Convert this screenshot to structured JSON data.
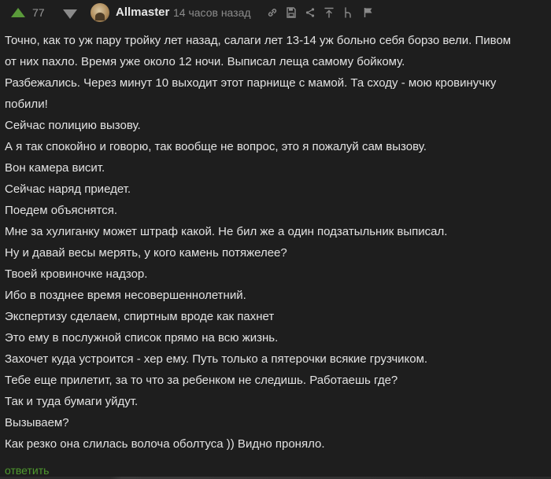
{
  "comment": {
    "rating": "77",
    "username": "Allmaster",
    "time": "14 часов назад",
    "icons": [
      "link-icon",
      "save-icon",
      "share-icon",
      "go-to-parent-icon",
      "branch-icon",
      "flag-icon"
    ],
    "lines": [
      "Точно, как то уж пару тройку лет назад, салаги лет 13-14 уж больно себя борзо вели. Пивом",
      "от них пахло. Время уже около 12 ночи. Выписал леща самому бойкому.",
      "Разбежались. Через минут 10 выходит этот парнище с мамой. Та сходу - мою кровинучку",
      "побили!",
      "Сейчас полицию вызову.",
      "А я так спокойно и говорю, так вообще не вопрос, это я пожалуй сам вызову.",
      "Вон камера висит.",
      "Сейчас наряд приедет.",
      "Поедем объяснятся.",
      "Мне за хулиганку может штраф какой. Не бил же а один подзатыльник выписал.",
      "Ну и давай весы мерять, у кого камень потяжелее?",
      "Твоей кровиночке надзор.",
      "Ибо в позднее время несовершеннолетний.",
      "Экспертизу сделаем, спиртным вроде как пахнет",
      "Это ему в послужной список прямо на всю жизнь.",
      "Захочет куда устроится - хер ему. Путь только а пятерочки всякие грузчиком.",
      "Тебе еще прилетит, за то что за ребенком не следишь. Работаешь где?",
      "Так и туда бумаги уйдут.",
      "Вызываем?",
      "Как резко она слилась волоча оболтуса )) Видно проняло."
    ],
    "reply_label": "ответить"
  },
  "colors": {
    "background": "#1e1e1e",
    "upvote": "#5a9a3a",
    "reply": "#4f9a2e",
    "text": "#e3e3e3",
    "muted": "#8c8c8c"
  }
}
